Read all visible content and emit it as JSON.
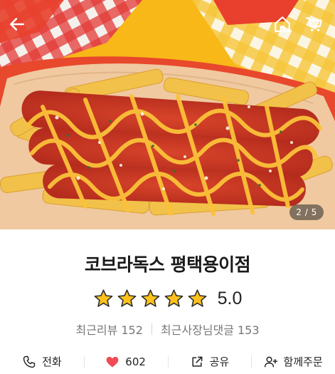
{
  "header": {
    "back_icon": "arrow-left-icon",
    "home_icon": "home-icon",
    "cart_icon": "cart-icon",
    "page_indicator": "2 / 5"
  },
  "store": {
    "name": "코브라독스 평택용이점",
    "rating": 5.0,
    "rating_text": "5.0",
    "star_count": 5,
    "star_color": "#FFC21C"
  },
  "reviews": {
    "recent_label": "최근리뷰",
    "recent_count": "152",
    "owner_label": "최근사장님댓글",
    "owner_count": "153"
  },
  "actions": {
    "call_label": "전화",
    "like_count": "602",
    "share_label": "공유",
    "group_order_label": "함께주문",
    "heart_color": "#F24B55"
  }
}
